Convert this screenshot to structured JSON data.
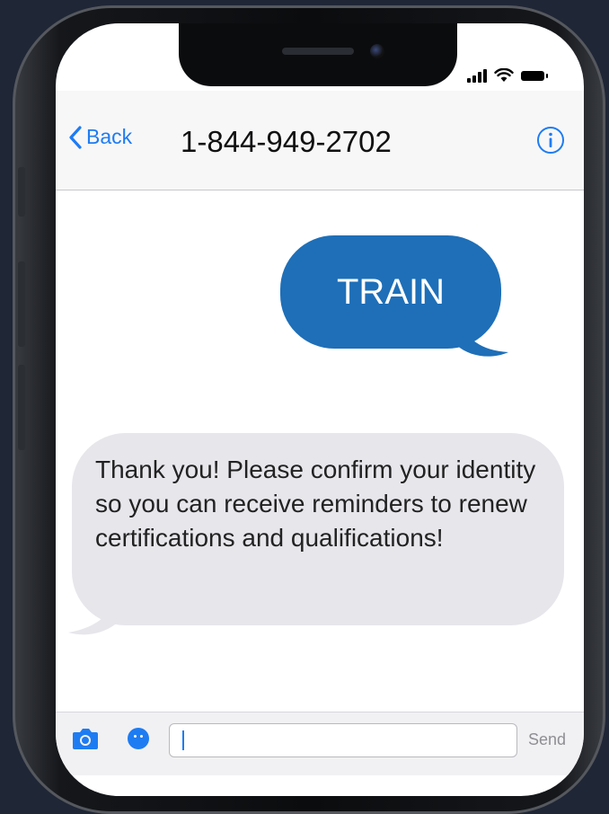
{
  "header": {
    "back_label": "Back",
    "contact": "1-844-949-2702"
  },
  "messages": [
    {
      "direction": "outgoing",
      "text": "TRAIN"
    },
    {
      "direction": "incoming",
      "text": "Thank you! Please confirm your identity so you can receive reminders to renew certifications and qualifications!"
    }
  ],
  "composer": {
    "value": "",
    "send_label": "Send"
  },
  "colors": {
    "accent": "#1e7cf2",
    "outgoing_bubble": "#1e6fb8",
    "incoming_bubble": "#e6e6eb",
    "background": "#1f2636"
  },
  "icons": {
    "back": "chevron-left-icon",
    "info": "info-icon",
    "camera": "camera-icon",
    "apps": "app-store-icon"
  }
}
